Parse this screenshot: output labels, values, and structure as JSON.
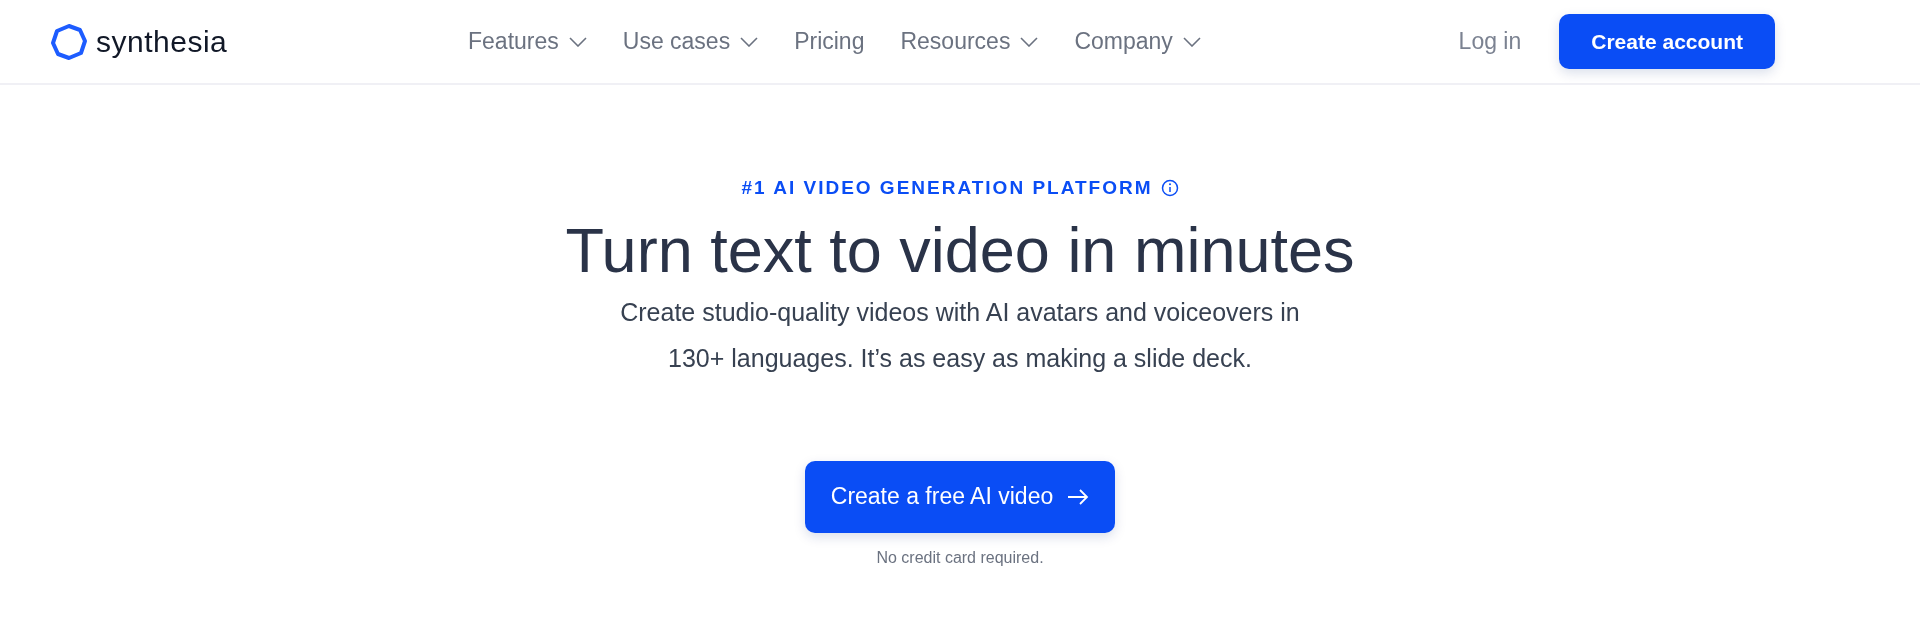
{
  "brand": {
    "name": "synthesia"
  },
  "nav": [
    {
      "label": "Features",
      "has_menu": true
    },
    {
      "label": "Use cases",
      "has_menu": true
    },
    {
      "label": "Pricing",
      "has_menu": false
    },
    {
      "label": "Resources",
      "has_menu": true
    },
    {
      "label": "Company",
      "has_menu": true
    }
  ],
  "login": "Log in",
  "signup": "Create account",
  "hero": {
    "eyebrow": "#1 AI VIDEO GENERATION PLATFORM",
    "title": "Turn text to video in minutes",
    "subtitle_lines": [
      "Create studio-quality videos with AI avatars and voiceovers in",
      "130+ languages. It’s as easy as making a slide deck."
    ],
    "cta": "Create a free AI video",
    "note": "No credit card required."
  }
}
